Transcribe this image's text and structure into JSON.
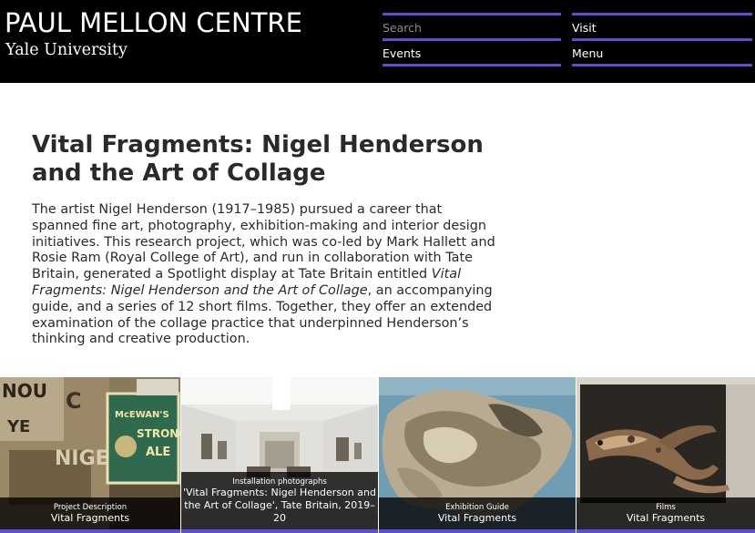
{
  "header": {
    "logo_title": "PAUL MELLON CENTRE",
    "logo_subtitle": "Yale University",
    "search_placeholder": "Search",
    "nav": {
      "visit": "Visit",
      "events": "Events",
      "menu": "Menu"
    },
    "accent_color": "#5a4fcf"
  },
  "main": {
    "title": "Vital Fragments: Nigel Henderson and the Art of Collage",
    "intro_before_italic": "The artist Nigel Henderson (1917–1985) pursued a career that spanned fine art, photography, exhibition-making and interior design initiatives. This research project, which was co-led by Mark Hallett and Rosie Ram (Royal College of Art), and run in collaboration with Tate Britain, generated a Spotlight display at Tate Britain entitled ",
    "intro_italic": "Vital Fragments: Nigel Henderson and the Art of Collage",
    "intro_after_italic": ", an accompanying guide, and a series of 12 short films. Together, they offer an extended examination of the collage practice that underpinned Henderson’s thinking and creative production."
  },
  "tiles": [
    {
      "kicker": "Project Description",
      "title": "Vital Fragments"
    },
    {
      "kicker": "Installation photographs",
      "title": "'Vital Fragments: Nigel Henderson and the Art of Collage', Tate Britain, 2019–20"
    },
    {
      "kicker": "Exhibition Guide",
      "title": "Vital Fragments"
    },
    {
      "kicker": "Films",
      "title": "Vital Fragments"
    }
  ]
}
